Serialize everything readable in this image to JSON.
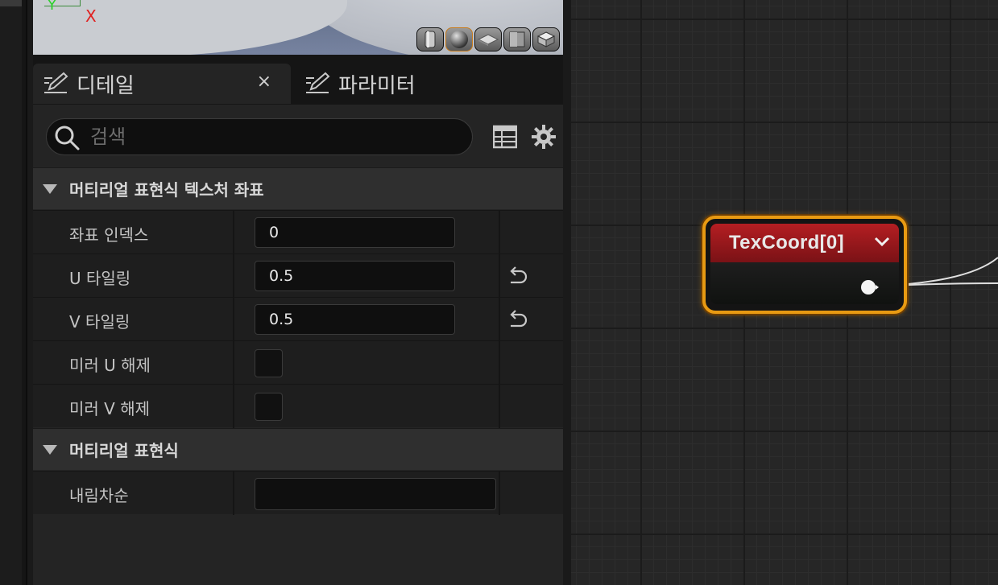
{
  "preview": {
    "axis_y": "Y",
    "axis_x": "X",
    "shape_buttons": [
      "cylinder",
      "sphere",
      "plane",
      "cube",
      "custom-mesh"
    ]
  },
  "tabs": [
    {
      "label": "디테일",
      "active": true,
      "closable": true,
      "close_glyph": "×"
    },
    {
      "label": "파라미터",
      "active": false
    }
  ],
  "search": {
    "placeholder": "검색",
    "value": ""
  },
  "sections": [
    {
      "title": "머티리얼 표현식 텍스처 좌표",
      "rows": [
        {
          "name": "좌표 인덱스",
          "value": "0",
          "type": "number",
          "reset": false
        },
        {
          "name": "U 타일링",
          "value": "0.5",
          "type": "number",
          "reset": true
        },
        {
          "name": "V 타일링",
          "value": "0.5",
          "type": "number",
          "reset": true
        },
        {
          "name": "미러 U 해제",
          "checked": false,
          "type": "checkbox"
        },
        {
          "name": "미러 V 해제",
          "checked": false,
          "type": "checkbox"
        }
      ]
    },
    {
      "title": "머티리얼 표현식",
      "rows": [
        {
          "name": "내림차순",
          "value": "",
          "type": "text"
        }
      ]
    }
  ],
  "node": {
    "title": "TexCoord[0]",
    "header_color": "#b41e22",
    "border_color": "#e89a12"
  },
  "colors": {
    "panel_bg": "#242424",
    "category_bg": "#2f2f2f",
    "row_bg": "#1e1e1e",
    "graph_bg": "#262626",
    "accent_orange": "#e89a12"
  }
}
